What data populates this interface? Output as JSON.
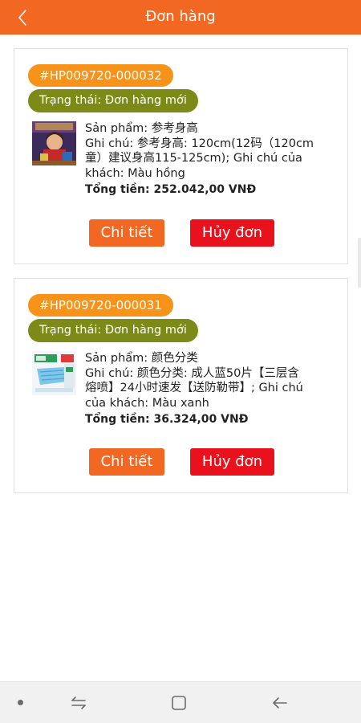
{
  "header": {
    "title": "Đơn hàng"
  },
  "orders": [
    {
      "id": "#HP009720-000032",
      "status": "Trạng thái: Đơn hàng mới",
      "product_line": "Sản phẩm: 参考身高",
      "note_lines": [
        "Ghi chú: 参考身高: 120cm(12码（120cm",
        "童）建议身高115-125cm); Ghi chú của",
        "khách: Màu hồng"
      ],
      "total": "Tổng tiền: 252.042,00 VNĐ",
      "detail_label": "Chi tiết",
      "cancel_label": "Hủy đơn"
    },
    {
      "id": "#HP009720-000031",
      "status": "Trạng thái: Đơn hàng mới",
      "product_line": "Sản phẩm: 颜色分类",
      "note_lines": [
        "Ghi chú: 颜色分类: 成人蓝50片【三层含",
        "熔喷】24小时速发【送防勒带】; Ghi chú",
        "của khách: Màu xanh"
      ],
      "total": "Tổng tiền: 36.324,00 VNĐ",
      "detail_label": "Chi tiết",
      "cancel_label": "Hủy đơn"
    }
  ],
  "icons": {
    "back": "chevron-left-icon",
    "nav_recent": "recent-apps-icon",
    "nav_home": "home-icon",
    "nav_back": "back-arrow-icon"
  },
  "colors": {
    "brand": "#f26722",
    "order_id_badge": "#f69318",
    "status_badge": "#7c8b17",
    "cancel": "#e8111c"
  }
}
